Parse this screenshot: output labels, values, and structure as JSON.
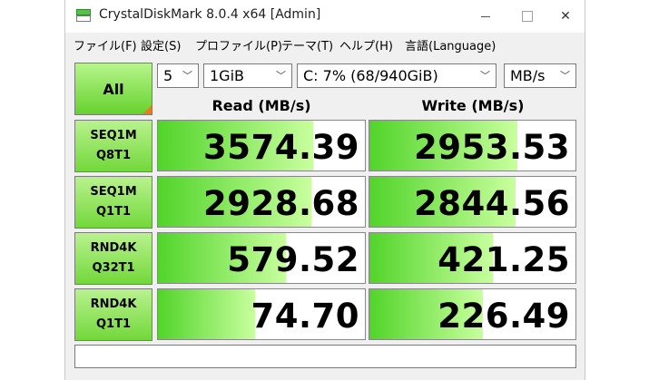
{
  "window": {
    "title": "CrystalDiskMark 8.0.4 x64 [Admin]"
  },
  "menu": [
    "ファイル(F)",
    "設定(S)",
    "プロファイル(P)",
    "テーマ(T)",
    "ヘルプ(H)",
    "言語(Language)"
  ],
  "controls": {
    "all_label": "All",
    "count": "5",
    "size": "1GiB",
    "drive": "C: 7% (68/940GiB)",
    "unit": "MB/s"
  },
  "headers": {
    "read": "Read (MB/s)",
    "write": "Write (MB/s)"
  },
  "rows": [
    {
      "line1": "SEQ1M",
      "line2": "Q8T1",
      "read": "3574.39",
      "write": "2953.53",
      "read_fill": 0.75,
      "write_fill": 0.72
    },
    {
      "line1": "SEQ1M",
      "line2": "Q1T1",
      "read": "2928.68",
      "write": "2844.56",
      "read_fill": 0.74,
      "write_fill": 0.71
    },
    {
      "line1": "RND4K",
      "line2": "Q32T1",
      "read": "579.52",
      "write": "421.25",
      "read_fill": 0.62,
      "write_fill": 0.6
    },
    {
      "line1": "RND4K",
      "line2": "Q1T1",
      "read": "74.70",
      "write": "226.49",
      "read_fill": 0.47,
      "write_fill": 0.55
    }
  ],
  "colors": {
    "fill_dark": "#52d42a",
    "fill_light": "#c8ff9e",
    "accent_corner": "#e87d1e"
  }
}
